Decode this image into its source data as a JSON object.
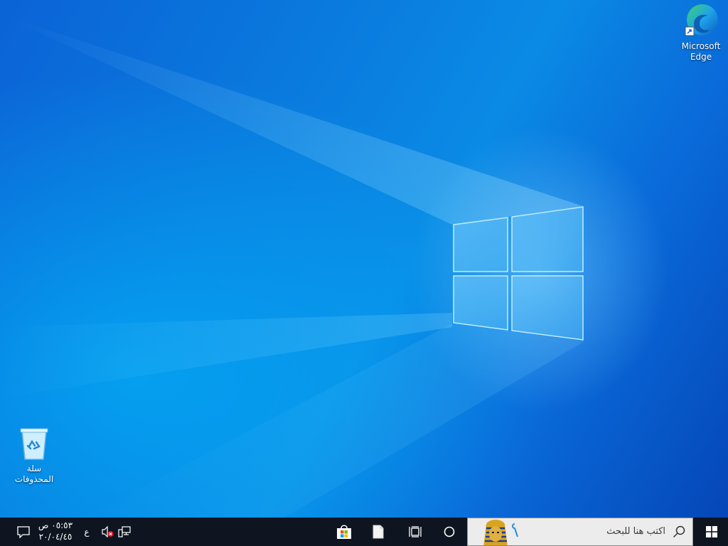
{
  "desktop": {
    "icons": [
      {
        "label_line1": "Microsoft",
        "label_line2": "Edge",
        "icon": "edge-icon"
      },
      {
        "label_line1": "سلة",
        "label_line2": "المحذوفات",
        "icon": "recycle-bin-icon"
      }
    ]
  },
  "taskbar": {
    "start_icon": "windows-start-icon",
    "search_placeholder": "اكتب هنا للبحث",
    "search_icon": "search-icon",
    "cortana_icon": "cortana-circle-icon",
    "taskview_icon": "task-view-icon",
    "file_icon": "document-icon",
    "store_icon": "microsoft-store-icon",
    "tray": {
      "network_icon": "network-disconnected-icon",
      "volume_icon": "volume-muted-icon",
      "language": "ع",
      "time": "٠٥:٥٣ ص",
      "date": "٢٠/٠٤/٤٥",
      "notification_icon": "action-center-icon"
    }
  },
  "colors": {
    "taskbar": "#0e1520",
    "desktop_accent": "#0a78dd",
    "search_bg": "#ececec"
  }
}
